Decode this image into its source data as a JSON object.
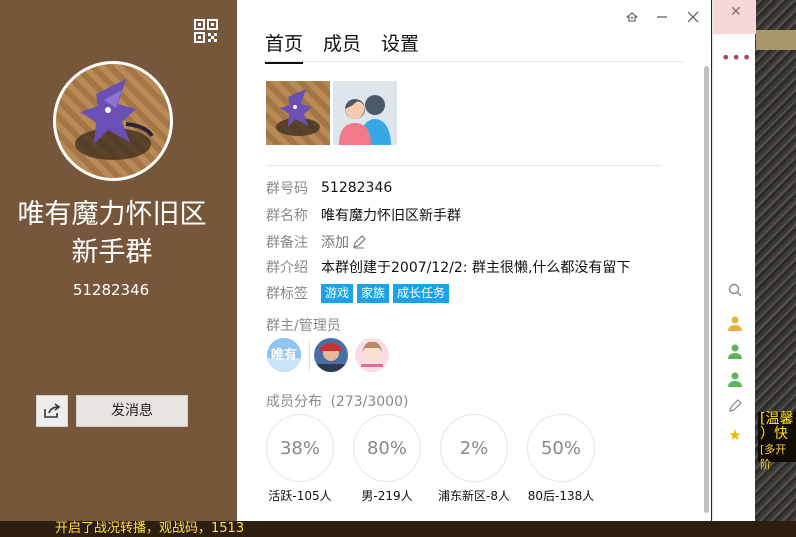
{
  "tabs": [
    {
      "label": "首页",
      "active": true
    },
    {
      "label": "成员",
      "active": false
    },
    {
      "label": "设置",
      "active": false
    }
  ],
  "group": {
    "name_line1": "唯有魔力怀旧区",
    "name_line2": "新手群",
    "id": "51282346"
  },
  "left_actions": {
    "send_message": "发消息"
  },
  "info": {
    "id_label": "群号码",
    "id_value": "51282346",
    "name_label": "群名称",
    "name_value": "唯有魔力怀旧区新手群",
    "remark_label": "群备注",
    "remark_value": "添加",
    "intro_label": "群介绍",
    "intro_value": "本群创建于2007/12/2:  群主很懒,什么都没有留下",
    "tags_label": "群标签",
    "tags": [
      "游戏",
      "家族",
      "成长任务"
    ]
  },
  "admins": {
    "title": "群主/管理员",
    "first_avatar_text": "唯有"
  },
  "distribution": {
    "title": "成员分布",
    "count": "(273/3000)",
    "stats": [
      {
        "value": "38%",
        "label": "活跃-105人"
      },
      {
        "value": "80%",
        "label": "男-219人"
      },
      {
        "value": "2%",
        "label": "浦东新区-8人"
      },
      {
        "value": "50%",
        "label": "80后-138人"
      }
    ]
  },
  "background": {
    "bottom_text": "开启了战况转播，观战码，1513",
    "yellow_text_1": "[温馨",
    "yellow_text_2": "）快",
    "yellow_text_3": "[多开阶"
  },
  "colors": {
    "left_panel": "#77573c",
    "tag": "#1aa3e8",
    "text": "#111111",
    "label": "#8a8a8a"
  }
}
